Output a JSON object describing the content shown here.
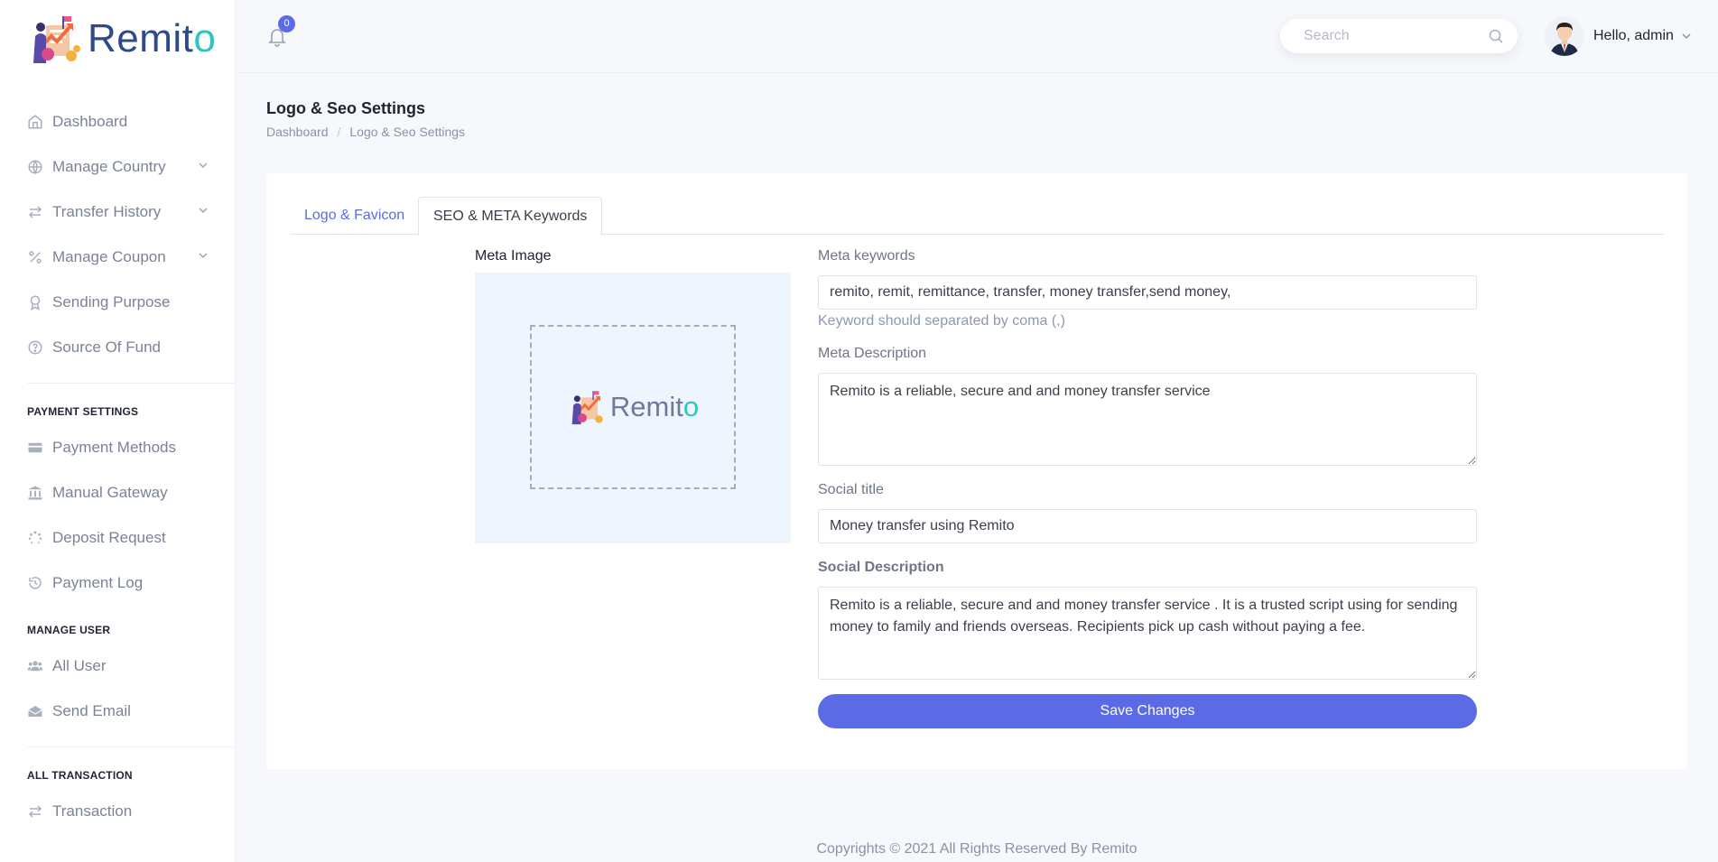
{
  "brand": {
    "name_main": "Remit",
    "name_accent": "o"
  },
  "sidebar": {
    "items": [
      {
        "label": "Dashboard",
        "icon": "home-icon",
        "has_chevron": false
      },
      {
        "label": "Manage Country",
        "icon": "globe-icon",
        "has_chevron": true
      },
      {
        "label": "Transfer History",
        "icon": "exchange-icon",
        "has_chevron": true
      },
      {
        "label": "Manage Coupon",
        "icon": "percent-icon",
        "has_chevron": true
      },
      {
        "label": "Sending Purpose",
        "icon": "award-icon",
        "has_chevron": false
      },
      {
        "label": "Source Of Fund",
        "icon": "question-icon",
        "has_chevron": false
      }
    ],
    "payment_heading": "PAYMENT SETTINGS",
    "payment_items": [
      {
        "label": "Payment Methods",
        "icon": "credit-card-icon"
      },
      {
        "label": "Manual Gateway",
        "icon": "bank-icon"
      },
      {
        "label": "Deposit Request",
        "icon": "spinner-icon"
      },
      {
        "label": "Payment Log",
        "icon": "history-icon"
      }
    ],
    "user_heading": "MANAGE USER",
    "user_items": [
      {
        "label": "All User",
        "icon": "users-icon"
      },
      {
        "label": "Send Email",
        "icon": "envelope-icon"
      }
    ],
    "transaction_heading": "ALL TRANSACTION",
    "transaction_items": [
      {
        "label": "Transaction",
        "icon": "exchange-icon"
      }
    ]
  },
  "header": {
    "notification_count": "0",
    "search_placeholder": "Search",
    "greeting": "Hello, admin"
  },
  "page": {
    "title": "Logo & Seo Settings",
    "breadcrumb": [
      "Dashboard",
      "Logo & Seo Settings"
    ]
  },
  "tabs": [
    {
      "label": "Logo & Favicon",
      "active": false
    },
    {
      "label": "SEO & META Keywords",
      "active": true
    }
  ],
  "form": {
    "meta_image_label": "Meta Image",
    "meta_keywords_label": "Meta keywords",
    "meta_keywords_value": "remito, remit, remittance, transfer, money transfer,send money,",
    "meta_keywords_hint": "Keyword should separated by coma (,)",
    "meta_description_label": "Meta Description",
    "meta_description_value": "Remito is a reliable, secure and and money transfer service",
    "social_title_label": "Social title",
    "social_title_value": "Money transfer using Remito",
    "social_description_label": "Social Description",
    "social_description_value": "Remito is a reliable, secure and and money transfer service . It is a trusted script using for sending money to family and friends overseas. Recipients pick up cash without paying a fee.",
    "save_label": "Save Changes"
  },
  "footer": {
    "text": "Copyrights © 2021 All Rights Reserved By Remito"
  },
  "colors": {
    "accent": "#5b6be6",
    "brand_blue": "#2f4a8a",
    "brand_teal": "#2dc5c0",
    "meta_image_bg": "#eef5fe"
  }
}
